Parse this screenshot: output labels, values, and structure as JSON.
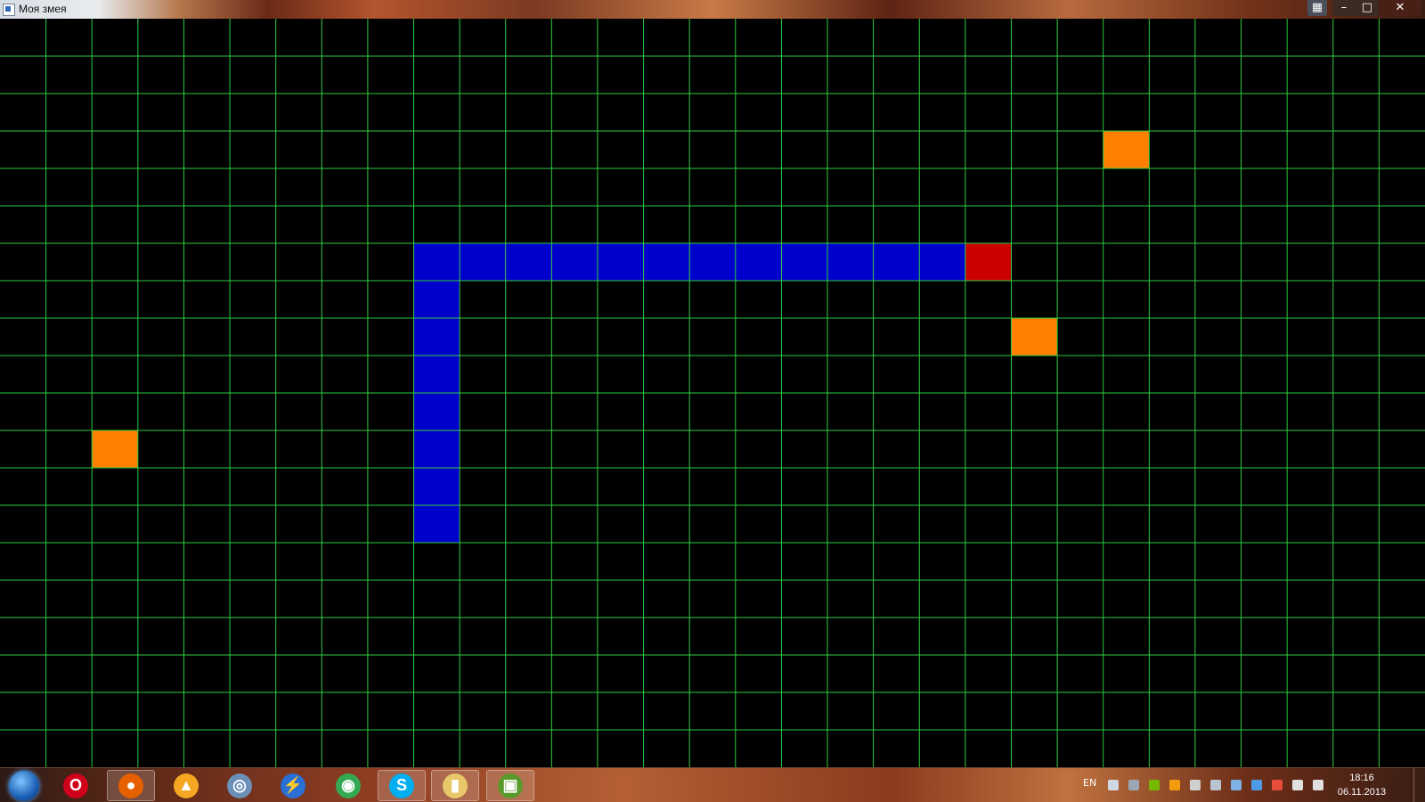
{
  "window": {
    "title": "Моя змея",
    "buttons": {
      "minimize": "–",
      "maximize": "□",
      "close": "✕",
      "snap": "▦"
    }
  },
  "game": {
    "grid": {
      "columns": 31,
      "rows": 20
    },
    "colors": {
      "background": "#000000",
      "grid_lines": "#2ecc40",
      "snake_body": "#0000cc",
      "snake_head": "#cc0000",
      "food": "#ff8000"
    },
    "snake": {
      "head": [
        21,
        6
      ],
      "body": [
        [
          20,
          6
        ],
        [
          19,
          6
        ],
        [
          18,
          6
        ],
        [
          17,
          6
        ],
        [
          16,
          6
        ],
        [
          15,
          6
        ],
        [
          14,
          6
        ],
        [
          13,
          6
        ],
        [
          12,
          6
        ],
        [
          11,
          6
        ],
        [
          10,
          6
        ],
        [
          9,
          6
        ],
        [
          9,
          7
        ],
        [
          9,
          8
        ],
        [
          9,
          9
        ],
        [
          9,
          10
        ],
        [
          9,
          11
        ],
        [
          9,
          12
        ],
        [
          9,
          13
        ]
      ]
    },
    "food": [
      [
        24,
        3
      ],
      [
        22,
        8
      ],
      [
        2,
        11
      ]
    ]
  },
  "taskbar": {
    "apps": [
      {
        "name": "start",
        "icon": "windows-start-icon",
        "label": "",
        "color": "#1a5fb4"
      },
      {
        "name": "opera",
        "icon": "opera-icon",
        "label": "O",
        "color": "#d0021b"
      },
      {
        "name": "firefox",
        "icon": "firefox-icon",
        "label": "●",
        "color": "#e66000",
        "active": true
      },
      {
        "name": "aimp",
        "icon": "aimp-icon",
        "label": "▲",
        "color": "#f5a623"
      },
      {
        "name": "daemon",
        "icon": "daemon-tools-icon",
        "label": "◎",
        "color": "#6c8fb8"
      },
      {
        "name": "thunder",
        "icon": "lightning-icon",
        "label": "⚡",
        "color": "#2a6fd6"
      },
      {
        "name": "chrome",
        "icon": "chrome-icon",
        "label": "◉",
        "color": "#34a853"
      },
      {
        "name": "skype",
        "icon": "skype-icon",
        "label": "S",
        "color": "#00aff0",
        "active": true
      },
      {
        "name": "explorer",
        "icon": "folder-icon",
        "label": "▮",
        "color": "#e8c86a",
        "active": true
      },
      {
        "name": "snake",
        "icon": "snake-game-icon",
        "label": "▣",
        "color": "#5a9a2a",
        "active": true
      }
    ],
    "tray": {
      "language": "EN",
      "icons": [
        "keyboard-icon",
        "steam-icon",
        "nvidia-icon",
        "avast-icon",
        "network-icon",
        "usb-icon",
        "update-icon",
        "thunder-tray-icon",
        "flag-icon",
        "action-center-icon",
        "volume-icon"
      ],
      "time": "18:16",
      "date": "06.11.2013"
    }
  }
}
